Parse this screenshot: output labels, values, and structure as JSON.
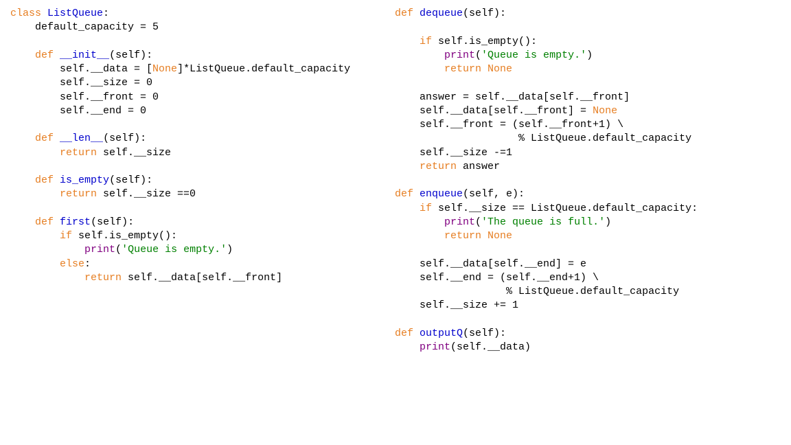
{
  "left": {
    "l1_class": "class",
    "l1_name": "ListQueue",
    "l2_attr": "default_capacity = 5",
    "l3_def": "def",
    "l3_name": "__init__",
    "l3_sig": "(self):",
    "l4": "self.__data = [",
    "l4_none": "None",
    "l4b": "]*ListQueue.default_capacity",
    "l5": "self.__size = 0",
    "l6": "self.__front = 0",
    "l7": "self.__end = 0",
    "l8_def": "def",
    "l8_name": "__len__",
    "l8_sig": "(self):",
    "l9_ret": "return",
    "l9_rest": " self.__size",
    "l10_def": "def",
    "l10_name": "is_empty",
    "l10_sig": "(self):",
    "l11_ret": "return",
    "l11_rest": " self.__size ==0",
    "l12_def": "def",
    "l12_name": "first",
    "l12_sig": "(self):",
    "l13_if": "if",
    "l13_rest": " self.is_empty():",
    "l14_print": "print",
    "l14_paren": "(",
    "l14_str": "'Queue is empty.'",
    "l14_close": ")",
    "l15_else": "else",
    "l15_colon": ":",
    "l16_ret": "return",
    "l16_rest": " self.__data[self.__front]"
  },
  "right": {
    "r1_def": "def",
    "r1_name": "dequeue",
    "r1_sig": "(self):",
    "r2_if": "if",
    "r2_rest": " self.is_empty():",
    "r3_print": "print",
    "r3_paren": "(",
    "r3_str": "'Queue is empty.'",
    "r3_close": ")",
    "r4_ret": "return",
    "r4_none": " None",
    "r5": "answer = self.__data[self.__front]",
    "r6": "self.__data[self.__front] = ",
    "r6_none": "None",
    "r7": "self.__front = (self.__front+1) \\",
    "r8": "                % ListQueue.default_capacity",
    "r9": "self.__size -=1",
    "r10_ret": "return",
    "r10_rest": " answer",
    "r11_def": "def",
    "r11_name": "enqueue",
    "r11_sig": "(self, e):",
    "r12_if": "if",
    "r12_rest": " self.__size == ListQueue.default_capacity:",
    "r13_print": "print",
    "r13_paren": "(",
    "r13_str": "'The queue is full.'",
    "r13_close": ")",
    "r14_ret": "return",
    "r14_none": " None",
    "r15": "self.__data[self.__end] = e",
    "r16": "self.__end = (self.__end+1) \\",
    "r17": "              % ListQueue.default_capacity",
    "r18": "self.__size += 1",
    "r19_def": "def",
    "r19_name": "outputQ",
    "r19_sig": "(self):",
    "r20_print": "print",
    "r20_rest": "(self.__data)"
  }
}
